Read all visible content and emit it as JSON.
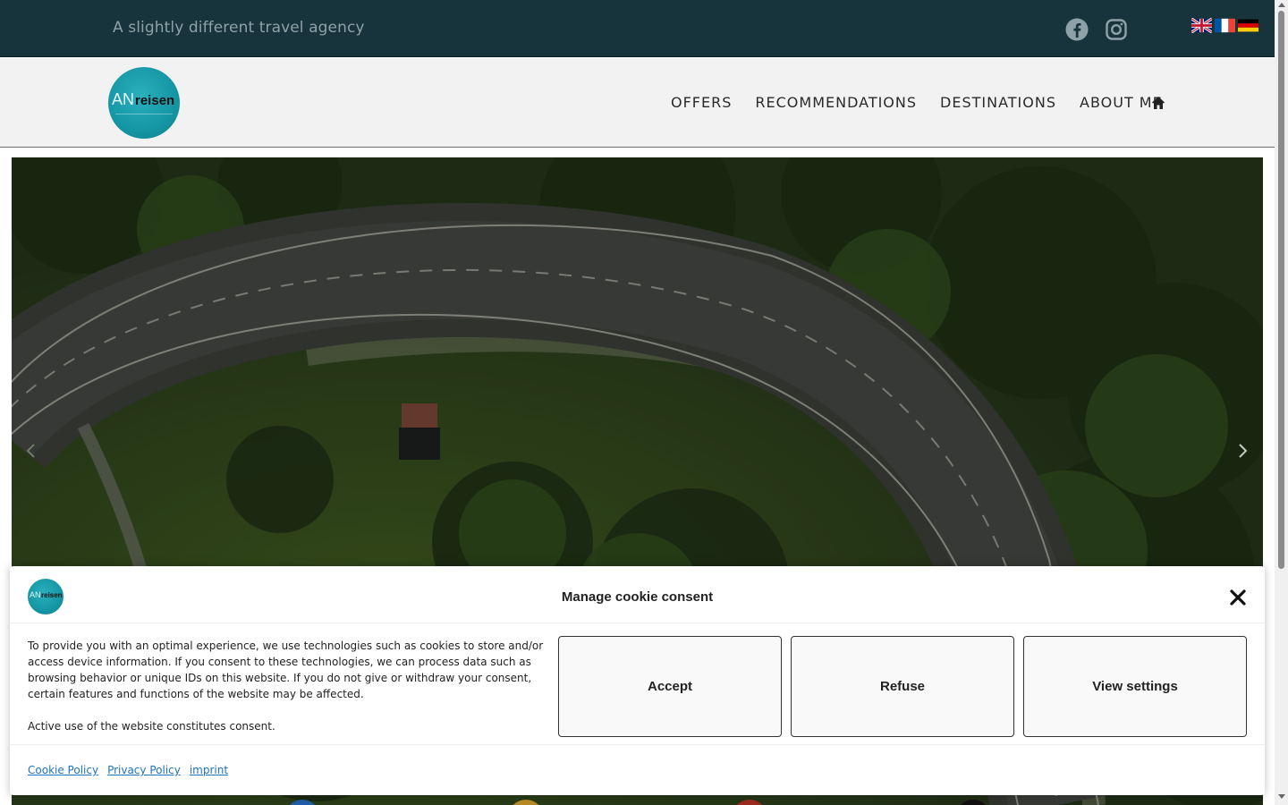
{
  "topbar": {
    "tagline": "A slightly different travel agency",
    "social": [
      {
        "icon": "facebook-icon"
      },
      {
        "icon": "instagram-icon"
      }
    ],
    "languages": [
      {
        "icon": "uk-flag-icon"
      },
      {
        "icon": "france-flag-icon"
      },
      {
        "icon": "germany-flag-icon"
      }
    ],
    "background": "#17343c"
  },
  "header": {
    "logo_an": "AN",
    "logo_reisen": "reisen",
    "nav": {
      "offers": "OFFERS",
      "recommendations": "RECOMMENDATIONS",
      "destinations": "DESTINATIONS",
      "about": "ABOUT ME"
    },
    "home_icon": "home-icon"
  },
  "hero": {
    "prev_icon": "chevron-left-icon",
    "next_icon": "chevron-right-icon"
  },
  "cookie": {
    "logo_an": "AN",
    "logo_reisen": "reisen",
    "title": "Manage cookie consent",
    "close_icon": "close-icon",
    "text1": "To provide you with an optimal experience, we use technologies such as cookies to store and/or access device information. If you consent to these technologies, we can process data such as browsing behavior or unique IDs on this website. If you do not give or withdraw your consent, certain features and functions of the website may be affected.",
    "text2": "Active use of the website constitutes consent.",
    "buttons": {
      "accept": "Accept",
      "refuse": "Refuse",
      "settings": "View settings"
    },
    "links": {
      "cookie_policy": "Cookie Policy",
      "privacy_policy": "Privacy Policy",
      "imprint": "imprint"
    },
    "link_color": "#1e73be"
  }
}
